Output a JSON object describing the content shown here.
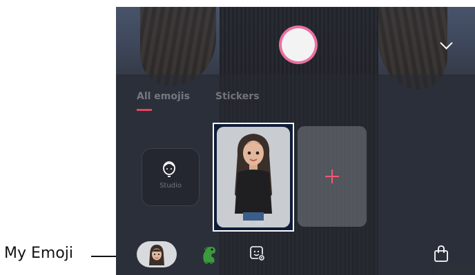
{
  "callout": {
    "label": "My Emoji"
  },
  "tabs": [
    {
      "label": "All emojis",
      "active": true
    },
    {
      "label": "Stickers",
      "active": false
    }
  ],
  "studio": {
    "label": "Studio",
    "icon": "face-outline-icon"
  },
  "selected_emoji": {
    "icon": "avatar-woman-long-hair-icon"
  },
  "add_card": {
    "icon": "plus-icon"
  },
  "toolbar": {
    "items": [
      {
        "name": "my-emoji-button",
        "icon": "avatar-icon"
      },
      {
        "name": "dino-button",
        "icon": "dinosaur-icon"
      },
      {
        "name": "sticker-settings-button",
        "icon": "sticker-gear-icon"
      },
      {
        "name": "shop-button",
        "icon": "shopping-bag-icon"
      }
    ]
  },
  "colors": {
    "accent": "#e8445e",
    "shutter_ring": "#e9709f",
    "selection_border": "#ffffff"
  }
}
